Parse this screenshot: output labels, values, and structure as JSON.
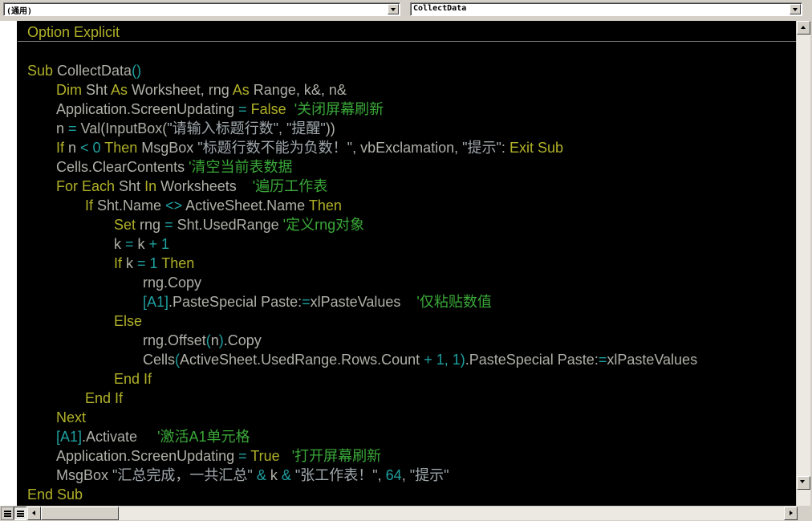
{
  "object_combo": {
    "value": "(通用)"
  },
  "procedure_combo": {
    "value": "CollectData"
  },
  "code": {
    "declarations": [
      [
        [
          "kw",
          "Option Explicit"
        ]
      ]
    ],
    "body": [
      [
        [
          "kw",
          "Sub "
        ],
        [
          "id",
          "CollectData"
        ],
        [
          "op",
          "()"
        ]
      ],
      [
        [
          "kw",
          "Dim "
        ],
        [
          "id",
          "Sht "
        ],
        [
          "kw",
          "As "
        ],
        [
          "id",
          "Worksheet, rng "
        ],
        [
          "kw",
          "As "
        ],
        [
          "id",
          "Range, k&, n&"
        ]
      ],
      [
        [
          "id",
          "Application.ScreenUpdating "
        ],
        [
          "op",
          "= "
        ],
        [
          "kw",
          "False "
        ],
        [
          "cm",
          " '关闭屏幕刷新"
        ]
      ],
      [
        [
          "id",
          "n "
        ],
        [
          "op",
          "= "
        ],
        [
          "id",
          "Val(InputBox("
        ],
        [
          "st",
          "\"请输入标题行数\", \"提醒\""
        ],
        [
          "id",
          "))"
        ]
      ],
      [
        [
          "kw",
          "If "
        ],
        [
          "id",
          "n "
        ],
        [
          "op",
          "< 0 "
        ],
        [
          "kw",
          "Then "
        ],
        [
          "id",
          "MsgBox "
        ],
        [
          "st",
          "\"标题行数不能为负数！\""
        ],
        [
          "id",
          ", vbExclamation, "
        ],
        [
          "st",
          "\"提示\""
        ],
        [
          "id",
          ": "
        ],
        [
          "kw",
          "Exit Sub"
        ]
      ],
      [
        [
          "id",
          "Cells.ClearContents "
        ],
        [
          "cm",
          "'清空当前表数据"
        ]
      ],
      [
        [
          "kw",
          "For Each "
        ],
        [
          "id",
          "Sht "
        ],
        [
          "kw",
          "In "
        ],
        [
          "id",
          "Worksheets    "
        ],
        [
          "cm",
          "'遍历工作表"
        ]
      ],
      [
        [
          "kw",
          "If "
        ],
        [
          "id",
          "Sht.Name "
        ],
        [
          "op",
          "<> "
        ],
        [
          "id",
          "ActiveSheet.Name "
        ],
        [
          "kw",
          "Then"
        ]
      ],
      [
        [
          "kw",
          "Set "
        ],
        [
          "id",
          "rng "
        ],
        [
          "op",
          "= "
        ],
        [
          "id",
          "Sht.UsedRange "
        ],
        [
          "cm",
          "'定义rng对象"
        ]
      ],
      [
        [
          "id",
          "k "
        ],
        [
          "op",
          "= "
        ],
        [
          "id",
          "k "
        ],
        [
          "op",
          "+ 1"
        ]
      ],
      [
        [
          "kw",
          "If "
        ],
        [
          "id",
          "k "
        ],
        [
          "op",
          "= 1 "
        ],
        [
          "kw",
          "Then"
        ]
      ],
      [
        [
          "id",
          "rng.Copy"
        ]
      ],
      [
        [
          "op",
          "[A1]"
        ],
        [
          "id",
          ".PasteSpecial Paste:"
        ],
        [
          "op",
          "="
        ],
        [
          "id",
          "xlPasteValues    "
        ],
        [
          "cm",
          "'仅粘贴数值"
        ]
      ],
      [
        [
          "kw",
          "Else"
        ]
      ],
      [
        [
          "id",
          "rng.Offset"
        ],
        [
          "op",
          "("
        ],
        [
          "id",
          "n"
        ],
        [
          "op",
          ")"
        ],
        [
          "id",
          ".Copy"
        ]
      ],
      [
        [
          "id",
          "Cells"
        ],
        [
          "op",
          "("
        ],
        [
          "id",
          "ActiveSheet.UsedRange.Rows.Count "
        ],
        [
          "op",
          "+ 1, 1)"
        ],
        [
          "id",
          ".PasteSpecial Paste:"
        ],
        [
          "op",
          "="
        ],
        [
          "id",
          "xlPasteValues"
        ]
      ],
      [
        [
          "kw",
          "End If"
        ]
      ],
      [
        [
          "kw",
          "End If"
        ]
      ],
      [
        [
          "kw",
          "Next"
        ]
      ],
      [
        [
          "op",
          "[A1]"
        ],
        [
          "id",
          ".Activate     "
        ],
        [
          "cm",
          "'激活A1单元格"
        ]
      ],
      [
        [
          "id",
          "Application.ScreenUpdating "
        ],
        [
          "op",
          "= "
        ],
        [
          "kw",
          "True  "
        ],
        [
          "cm",
          " '打开屏幕刷新"
        ]
      ],
      [
        [
          "id",
          "MsgBox "
        ],
        [
          "st",
          "\"汇总完成，一共汇总\""
        ],
        [
          "op",
          " & "
        ],
        [
          "id",
          "k "
        ],
        [
          "op",
          "& "
        ],
        [
          "st",
          "\"张工作表！\""
        ],
        [
          "id",
          ", "
        ],
        [
          "op",
          "64"
        ],
        [
          "id",
          ", "
        ],
        [
          "st",
          "\"提示\""
        ]
      ],
      [
        [
          "kw",
          "End Sub"
        ]
      ]
    ]
  },
  "colors": {
    "keyword": "#b0b028",
    "identifier": "#b0b0a8",
    "operator": "#1fa0a0",
    "comment": "#3aa838",
    "string": "#a0a8ac",
    "editor_background": "#000000"
  },
  "icons": {
    "object_dropdown": "chevron-down-icon",
    "procedure_dropdown": "chevron-down-icon",
    "scroll_up": "arrow-up-icon",
    "scroll_down": "arrow-down-icon",
    "scroll_left": "arrow-left-icon",
    "scroll_right": "arrow-right-icon",
    "procedure_view": "procedure-view-icon",
    "full_module_view": "full-module-view-icon"
  }
}
